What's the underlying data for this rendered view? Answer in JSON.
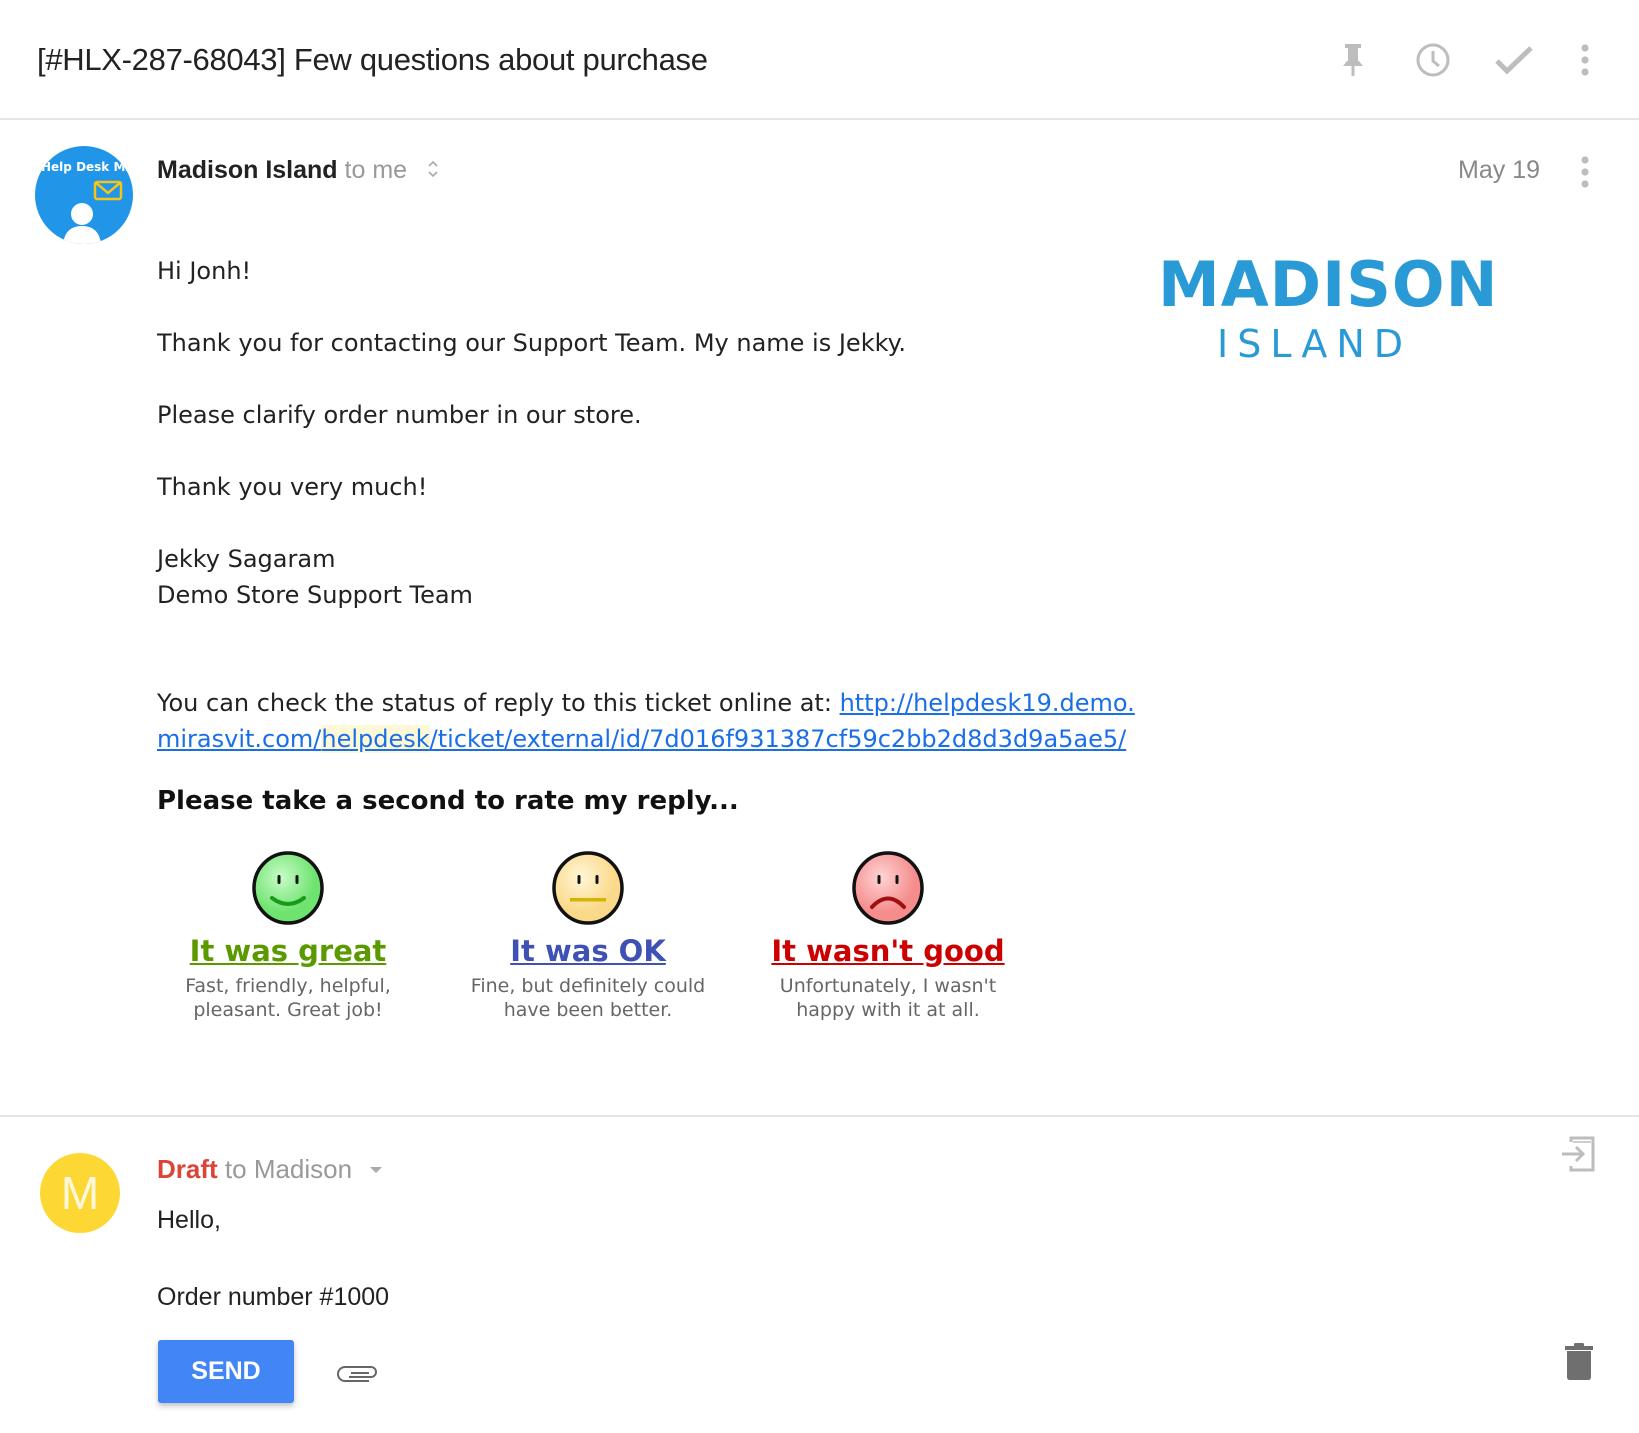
{
  "thread": {
    "subject": "[#HLX-287-68043] Few questions about purchase",
    "actions": [
      {
        "name": "pin",
        "icon": "pin-icon"
      },
      {
        "name": "snooze",
        "icon": "clock-icon"
      },
      {
        "name": "done",
        "icon": "check-icon"
      },
      {
        "name": "more",
        "icon": "more-vert-icon"
      }
    ]
  },
  "message": {
    "avatar_label": "Help Desk MX",
    "sender": "Madison Island",
    "recipient": "to me",
    "date": "May 19",
    "logo": {
      "line1": "MADISON",
      "line2": "ISLAND",
      "color": "#2a9ad6"
    },
    "body": {
      "greeting": "Hi Jonh!",
      "line1": "Thank you for contacting our Support Team. My name is Jekky.",
      "line2": "Please clarify order number in our store.",
      "line3": "Thank you very much!",
      "signature_name": "Jekky Sagaram",
      "signature_team": "Demo Store Support Team",
      "status_text": "You can check the status of reply to this ticket online at: ",
      "link_part1": "http://helpdesk19.demo.",
      "link_part2a": "mirasvit.com/",
      "link_part2b": "helpdesk",
      "link_part2c": "/ticket/external/id/7d016f931387cf59c2bb2d8d3d9a5ae5/"
    },
    "rating": {
      "heading": "Please take a second to rate my reply...",
      "options": [
        {
          "label": "It was great",
          "desc1": "Fast, friendly, helpful,",
          "desc2": "pleasant. Great job!",
          "color": "#5a9a00",
          "face": "happy"
        },
        {
          "label": "It was OK",
          "desc1": "Fine, but definitely could",
          "desc2": "have been better.",
          "color": "#3f51b5",
          "face": "neutral"
        },
        {
          "label": "It wasn't good",
          "desc1": "Unfortunately, I wasn't",
          "desc2": "happy with it at all.",
          "color": "#cc0000",
          "face": "sad"
        }
      ]
    }
  },
  "draft": {
    "avatar_letter": "M",
    "status": "Draft",
    "recipient": "to Madison",
    "line1": "Hello,",
    "line2": "Order number #1000",
    "send_label": "SEND"
  }
}
